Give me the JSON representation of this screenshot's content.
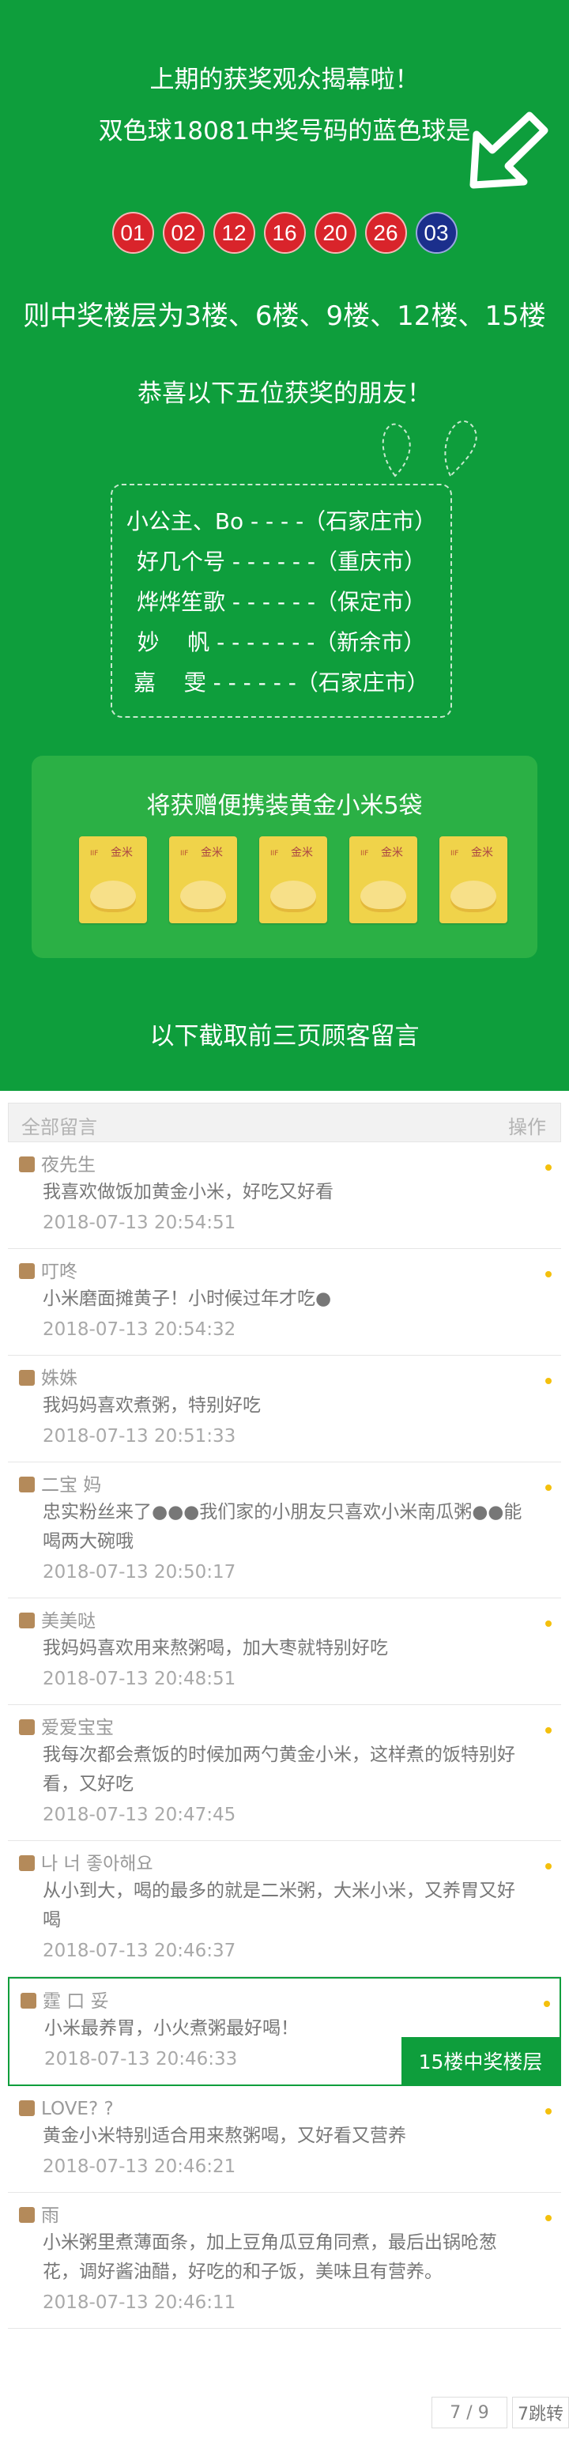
{
  "banner": {
    "line1": "上期的获奖观众揭幕啦！",
    "line2": "双色球18081中奖号码的蓝色球是",
    "balls_red": [
      "01",
      "02",
      "12",
      "16",
      "20",
      "26"
    ],
    "ball_blue": "03",
    "floors": "则中奖楼层为3楼、6楼、9楼、12楼、15楼",
    "congrats": "恭喜以下五位获奖的朋友！",
    "winners": [
      "小公主、Bo - - - -（石家庄市）",
      "好几个号 - - - - - -（重庆市）",
      "烨烨笙歌 - - - - - -（保定市）",
      "妙    帆 - - - - - - -（新余市）",
      "嘉    雯 - - - - - -（石家庄市）"
    ],
    "prize_title": "将获赠便携装黄金小米5袋",
    "bag_brand": "IIF",
    "bag_glyph": "金米",
    "footer": "以下截取前三页顾客留言"
  },
  "comments_header": {
    "left": "全部留言",
    "right": "操作"
  },
  "comments": [
    {
      "name": "夜先生",
      "content": "我喜欢做饭加黄金小米，好吃又好看",
      "time": "2018-07-13 20:54:51"
    },
    {
      "name": "叮咚",
      "content": "小米磨面摊黄子！小时候过年才吃●",
      "time": "2018-07-13 20:54:32"
    },
    {
      "name": "姝姝",
      "content": "我妈妈喜欢煮粥，特别好吃",
      "time": "2018-07-13 20:51:33"
    },
    {
      "name": "二宝 妈",
      "content": "忠实粉丝来了●●●我们家的小朋友只喜欢小米南瓜粥●●能喝两大碗哦",
      "time": "2018-07-13 20:50:17"
    },
    {
      "name": "美美哒",
      "content": "我妈妈喜欢用来熬粥喝，加大枣就特别好吃",
      "time": "2018-07-13 20:48:51"
    },
    {
      "name": "爱爱宝宝",
      "content": "我每次都会煮饭的时候加两勺黄金小米，这样煮的饭特别好看，又好吃",
      "time": "2018-07-13 20:47:45"
    },
    {
      "name": "나 너 좋아해요",
      "content": "从小到大，喝的最多的就是二米粥，大米小米，又养胃又好喝",
      "time": "2018-07-13 20:46:37"
    },
    {
      "name": "霆 口 妥",
      "content": "小米最养胃，小火煮粥最好喝！",
      "time": "2018-07-13 20:46:33",
      "highlight": "15楼中奖楼层"
    },
    {
      "name": "LOVE? ?",
      "content": "黄金小米特别适合用来熬粥喝，又好看又营养",
      "time": "2018-07-13 20:46:21"
    },
    {
      "name": "雨",
      "content": "小米粥里煮薄面条，加上豆角瓜豆角同煮，最后出锅呛葱花，调好酱油醋，好吃的和子饭，美味且有营养。",
      "time": "2018-07-13 20:46:11"
    }
  ],
  "pager": {
    "page": "7 / 9",
    "jump": "7跳转"
  }
}
